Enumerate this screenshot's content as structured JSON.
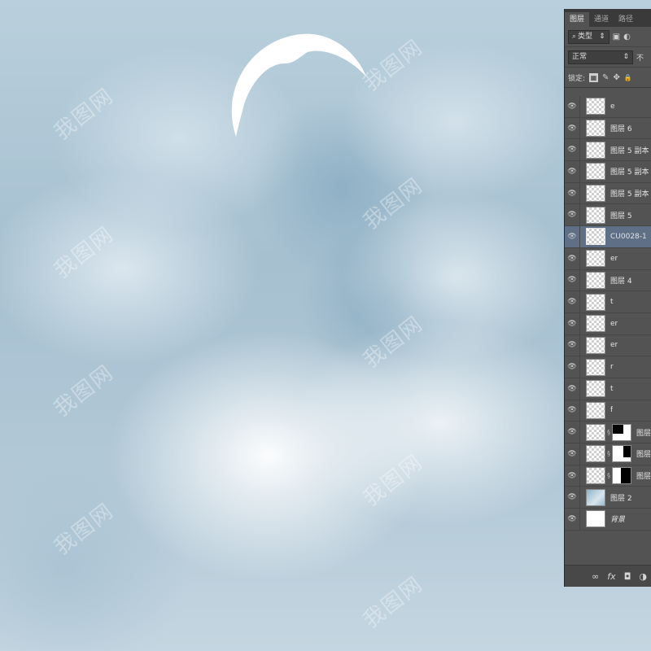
{
  "panel": {
    "tabs": [
      "图层",
      "通道",
      "路径"
    ],
    "filter_label": "类型",
    "blend_mode": "正常",
    "opacity_label": "不",
    "lock_label": "锁定:",
    "icons": {
      "search": "⌕",
      "filter_image": "▣",
      "filter_adjust": "◐",
      "dropdown": "⇕",
      "lock_pixels": "▦",
      "lock_brush": "✎",
      "lock_move": "✥",
      "lock_all": "🔒",
      "eye": "👁",
      "link": "∞",
      "fx": "fx",
      "mask": "◘",
      "adjust": "◑"
    }
  },
  "layers": [
    {
      "name": "e",
      "thumb": "transparent"
    },
    {
      "name": "图层 6",
      "thumb": "transparent"
    },
    {
      "name": "图层 5 副本",
      "thumb": "transparent"
    },
    {
      "name": "图层 5 副本",
      "thumb": "transparent"
    },
    {
      "name": "图层 5 副本",
      "thumb": "transparent"
    },
    {
      "name": "图层 5",
      "thumb": "transparent"
    },
    {
      "name": "CU0028-1",
      "thumb": "cu",
      "selected": true
    },
    {
      "name": "er",
      "thumb": "transparent"
    },
    {
      "name": "图层 4",
      "thumb": "transparent"
    },
    {
      "name": "t",
      "thumb": "transparent"
    },
    {
      "name": "er",
      "thumb": "transparent"
    },
    {
      "name": "er",
      "thumb": "transparent"
    },
    {
      "name": "r",
      "thumb": "transparent"
    },
    {
      "name": "t",
      "thumb": "transparent"
    },
    {
      "name": "f",
      "thumb": "transparent"
    },
    {
      "name": "图层",
      "thumb": "transparent",
      "mask": "m1"
    },
    {
      "name": "图层",
      "thumb": "transparent",
      "mask": "m2"
    },
    {
      "name": "图层",
      "thumb": "transparent",
      "mask": "m3"
    },
    {
      "name": "图层 2",
      "thumb": "photo"
    },
    {
      "name": "背景",
      "thumb": "white",
      "italic": true
    }
  ],
  "watermark": "我图网",
  "colors": {
    "panel_bg": "#535353",
    "selected_layer": "#5e6f86",
    "sky": "#a6c0d0"
  }
}
